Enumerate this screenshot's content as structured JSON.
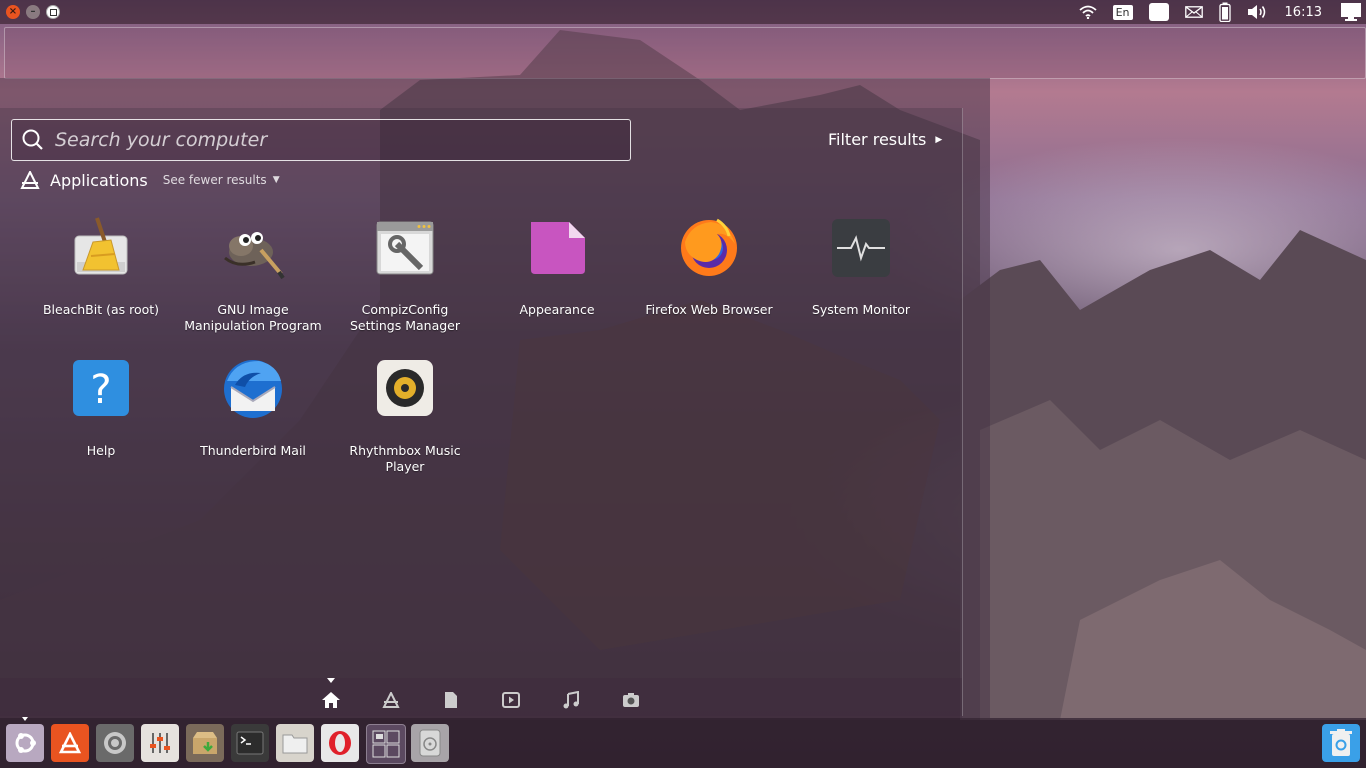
{
  "top_panel": {
    "language": "En",
    "clock": "16:13"
  },
  "search": {
    "placeholder": "Search your computer",
    "value": ""
  },
  "filter_results_label": "Filter results",
  "applications_section": {
    "title": "Applications",
    "see_fewer": "See fewer results"
  },
  "apps": [
    {
      "label": "BleachBit (as root)",
      "icon": "bleachbit-icon"
    },
    {
      "label": "GNU Image Manipulation Program",
      "icon": "gimp-icon"
    },
    {
      "label": "CompizConfig Settings Manager",
      "icon": "compizconfig-icon"
    },
    {
      "label": "Appearance",
      "icon": "appearance-icon"
    },
    {
      "label": "Firefox Web Browser",
      "icon": "firefox-icon"
    },
    {
      "label": "System Monitor",
      "icon": "system-monitor-icon"
    },
    {
      "label": "Help",
      "icon": "help-icon"
    },
    {
      "label": "Thunderbird Mail",
      "icon": "thunderbird-icon"
    },
    {
      "label": "Rhythmbox Music Player",
      "icon": "rhythmbox-icon"
    }
  ],
  "lenses": [
    "home-lens-icon",
    "applications-lens-icon",
    "files-lens-icon",
    "video-lens-icon",
    "music-lens-icon",
    "photos-lens-icon"
  ],
  "launcher": [
    "ubuntu-dash-icon",
    "software-center-icon",
    "system-settings-icon",
    "tweak-tool-icon",
    "archive-manager-icon",
    "terminal-icon",
    "files-icon",
    "opera-icon",
    "workspace-switcher-icon",
    "disk-icon",
    "trash-icon"
  ],
  "colors": {
    "ubuntu_orange": "#e95420",
    "appearance_pink": "#c855c0",
    "help_blue": "#2f8fe0"
  }
}
